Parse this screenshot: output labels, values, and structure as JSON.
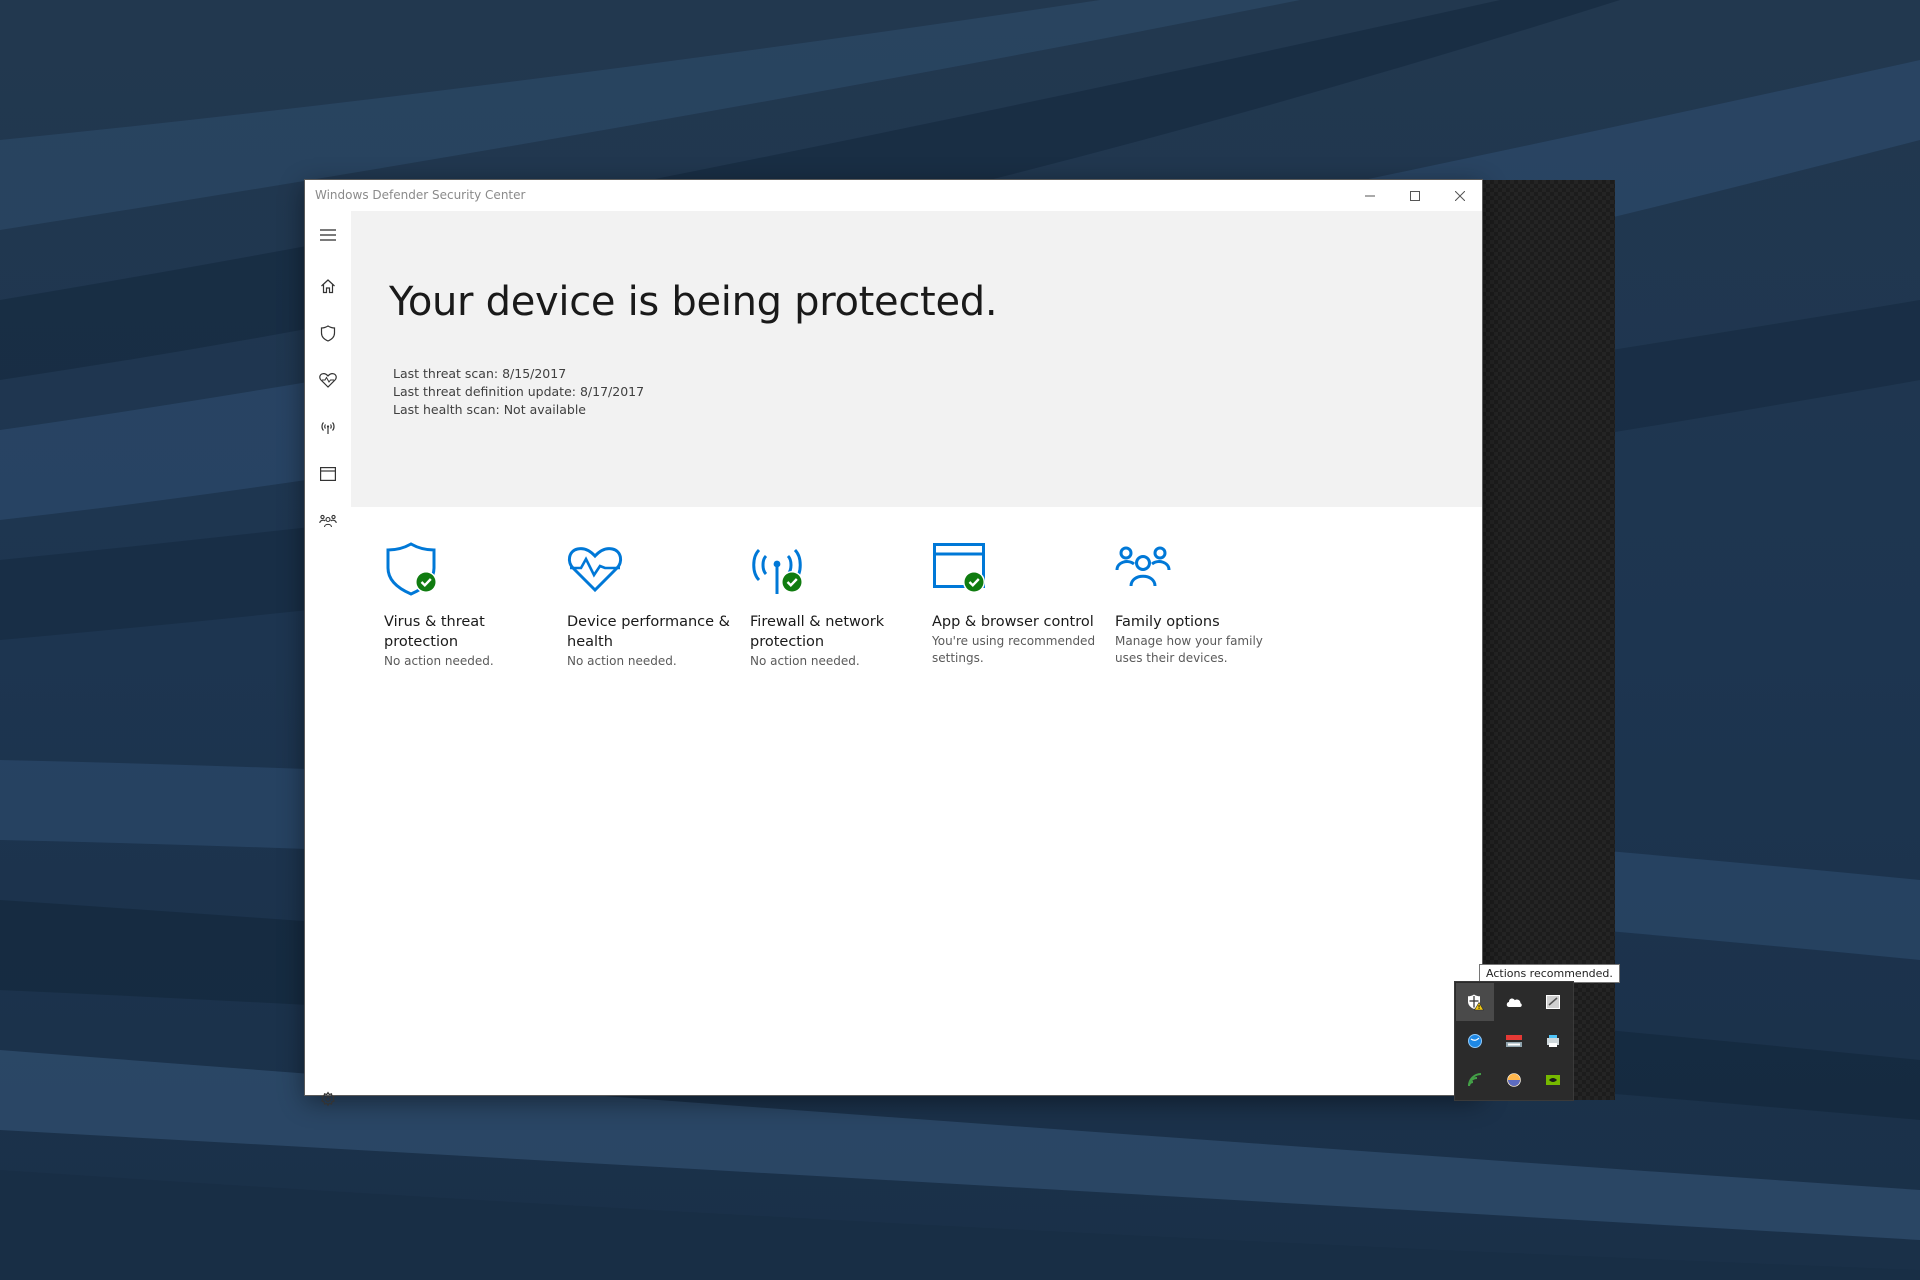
{
  "window": {
    "title": "Windows Defender Security Center"
  },
  "sidebar": {
    "items": [
      {
        "id": "menu",
        "icon": "hamburger-icon"
      },
      {
        "id": "home",
        "icon": "home-icon"
      },
      {
        "id": "virus",
        "icon": "shield-icon"
      },
      {
        "id": "health",
        "icon": "heart-icon"
      },
      {
        "id": "firewall",
        "icon": "antenna-icon"
      },
      {
        "id": "app",
        "icon": "browser-window-icon"
      },
      {
        "id": "family",
        "icon": "family-icon"
      }
    ],
    "settings_icon": "gear-icon"
  },
  "hero": {
    "heading": "Your device is being protected.",
    "scan_lines": [
      "Last threat scan:  8/15/2017",
      "Last threat definition update:  8/17/2017",
      "Last health scan:  Not available"
    ]
  },
  "tiles": [
    {
      "title": "Virus & threat protection",
      "subtitle": "No action needed.",
      "icon": "shield-check-icon"
    },
    {
      "title": "Device performance & health",
      "subtitle": "No action needed.",
      "icon": "heart-pulse-check-icon"
    },
    {
      "title": "Firewall & network protection",
      "subtitle": "No action needed.",
      "icon": "antenna-check-icon"
    },
    {
      "title": "App & browser control",
      "subtitle": "You're using recommended settings.",
      "icon": "browser-check-icon"
    },
    {
      "title": "Family options",
      "subtitle": "Manage how your family uses their devices.",
      "icon": "family-icon"
    }
  ],
  "tray": {
    "tooltip": "Actions recommended.",
    "icons": [
      "defender-warning-icon",
      "onedrive-icon",
      "storage-icon",
      "network-globe-icon",
      "ram-meter-icon",
      "printer-icon",
      "signal-icon",
      "color-ball-icon",
      "nvidia-icon"
    ]
  },
  "colors": {
    "accent": "#0078d7",
    "ok_green": "#107c10",
    "hero_bg": "#f2f2f2"
  }
}
